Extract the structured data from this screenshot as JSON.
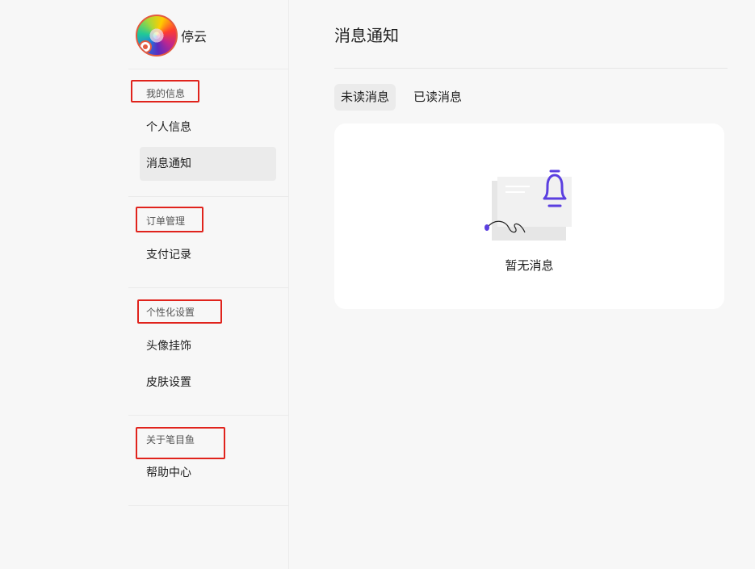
{
  "user": {
    "name": "停云"
  },
  "sidebar": {
    "sections": [
      {
        "title": "我的信息",
        "items": [
          {
            "label": "个人信息"
          },
          {
            "label": "消息通知"
          }
        ]
      },
      {
        "title": "订单管理",
        "items": [
          {
            "label": "支付记录"
          }
        ]
      },
      {
        "title": "个性化设置",
        "items": [
          {
            "label": "头像挂饰"
          },
          {
            "label": "皮肤设置"
          }
        ]
      },
      {
        "title": "关于笔目鱼",
        "items": [
          {
            "label": "帮助中心"
          }
        ]
      }
    ]
  },
  "main": {
    "title": "消息通知",
    "tabs": [
      {
        "label": "未读消息"
      },
      {
        "label": "已读消息"
      }
    ],
    "empty_text": "暂无消息"
  },
  "colors": {
    "accent": "#5b3fe0",
    "highlight_box": "#e0231c",
    "active_bg": "#ebebeb",
    "page_bg": "#f7f7f7"
  },
  "icons": {
    "bell": "bell-icon",
    "envelope": "envelope-icon"
  }
}
